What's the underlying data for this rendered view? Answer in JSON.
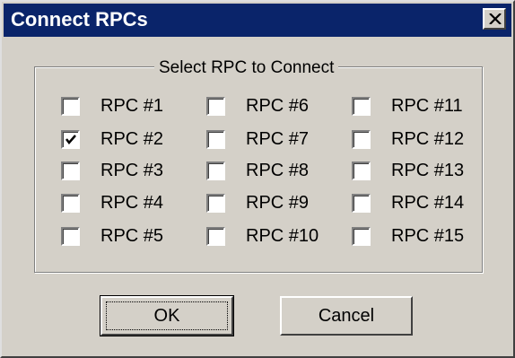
{
  "window": {
    "title": "Connect RPCs",
    "close_glyph": "×"
  },
  "group": {
    "label": "Select RPC to Connect"
  },
  "checkboxes": [
    {
      "label": "RPC #1",
      "checked": false
    },
    {
      "label": "RPC #2",
      "checked": true
    },
    {
      "label": "RPC #3",
      "checked": false
    },
    {
      "label": "RPC #4",
      "checked": false
    },
    {
      "label": "RPC #5",
      "checked": false
    },
    {
      "label": "RPC #6",
      "checked": false
    },
    {
      "label": "RPC #7",
      "checked": false
    },
    {
      "label": "RPC #8",
      "checked": false
    },
    {
      "label": "RPC #9",
      "checked": false
    },
    {
      "label": "RPC #10",
      "checked": false
    },
    {
      "label": "RPC #11",
      "checked": false
    },
    {
      "label": "RPC #12",
      "checked": false
    },
    {
      "label": "RPC #13",
      "checked": false
    },
    {
      "label": "RPC #14",
      "checked": false
    },
    {
      "label": "RPC #15",
      "checked": false
    }
  ],
  "buttons": {
    "ok_label": "OK",
    "cancel_label": "Cancel"
  },
  "colors": {
    "titlebar": "#0a246a",
    "face": "#d4d0c8"
  }
}
